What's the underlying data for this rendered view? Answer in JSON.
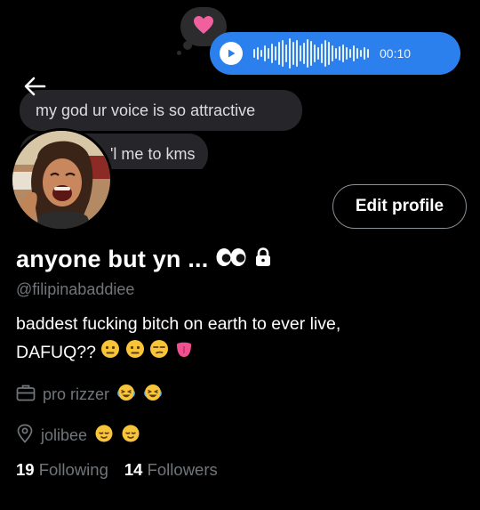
{
  "banner": {
    "voice_duration": "00:10",
    "messages": [
      {
        "text": "my god ur voice is so attractive"
      },
      {
        "text": "'l me to kms"
      }
    ]
  },
  "profile": {
    "display_name": "anyone but yn ...",
    "handle": "@filipinabaddiee",
    "bio_line1": "baddest fucking bitch on earth to ever live,",
    "bio_line2": "DAFUQ??",
    "profession": "pro rizzer",
    "location": "jolibee",
    "following_count": "19",
    "following_label": "Following",
    "followers_count": "14",
    "followers_label": "Followers"
  },
  "actions": {
    "edit_profile_label": "Edit profile"
  },
  "colors": {
    "background": "#000000",
    "voice_bubble": "#2b80ed",
    "message_bubble": "#26262a",
    "secondary_text": "#71767b",
    "heart": "#f0609e"
  },
  "icons": [
    "heart-icon",
    "play-icon",
    "back-arrow-icon",
    "eyes-emoji",
    "lock-icon",
    "briefcase-icon",
    "location-pin-icon",
    "neutral-face-emoji",
    "unamused-face-emoji",
    "tongue-emoji",
    "laughing-crying-emoji",
    "relieved-face-emoji"
  ]
}
